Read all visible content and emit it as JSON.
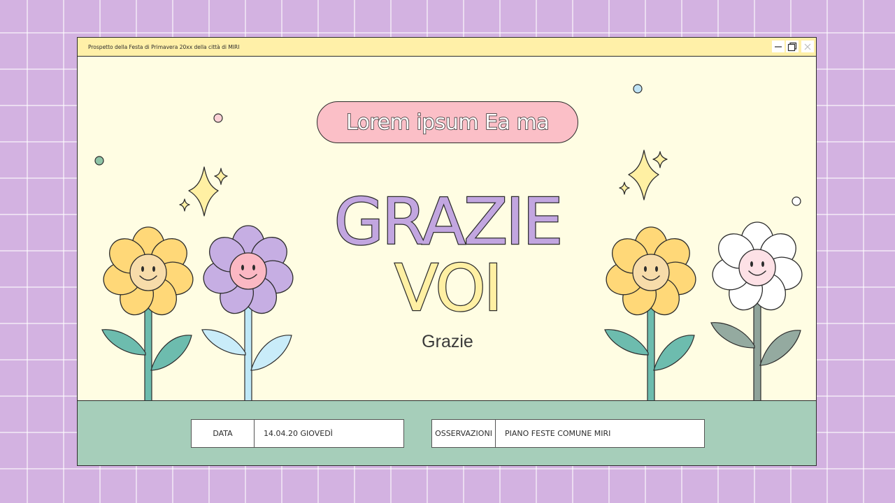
{
  "window": {
    "title": "Prospetto della Festa di Primavera 20xx della città di MIRI",
    "controls": [
      "minimize-icon",
      "restore-icon",
      "close-icon"
    ]
  },
  "slide": {
    "pill_text": "Lorem ipsum Ea ma",
    "headline_line1": "GRAZIE",
    "headline_line2": "VOI",
    "subtitle": "Grazie"
  },
  "footer": {
    "date_label": "DATA",
    "date_value": "14.04.20 GIOVEDÌ",
    "notes_label": "OSSERVAZIONI",
    "notes_value": "PIANO FESTE COMUNE MIRI"
  },
  "colors": {
    "background": "#d3b2e1",
    "window": "#fffde3",
    "titlebar": "#fff0a8",
    "ground": "#a6ceba",
    "pill": "#fbbfc7",
    "headline_purple": "#c2a6e0",
    "headline_yellow": "#fff0a3"
  },
  "decorations": [
    "sparkle-icon",
    "sparkle-icon",
    "flower-yellow",
    "flower-purple",
    "flower-yellow",
    "flower-white"
  ]
}
